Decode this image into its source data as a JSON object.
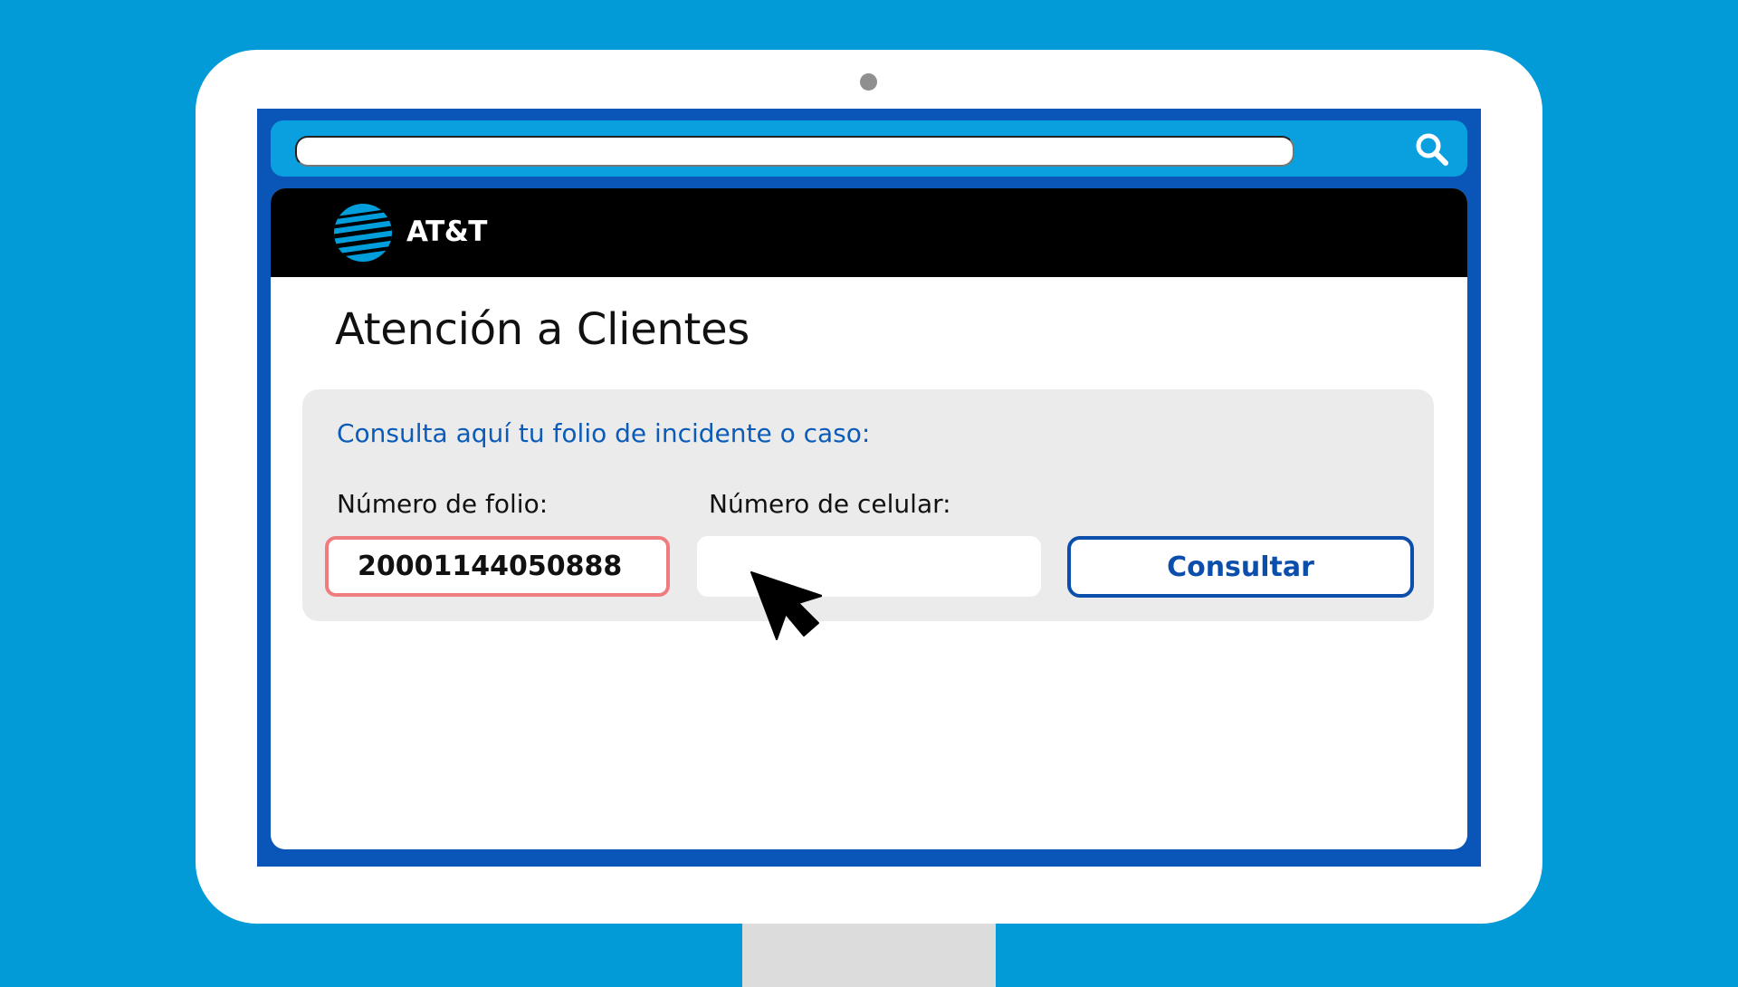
{
  "brand": {
    "name": "AT&T",
    "logo_icon": "att-globe-icon",
    "colors": {
      "background": "#039ad8",
      "screen_frame": "#0a56b8",
      "accent_blue": "#0b5cb8",
      "folio_border": "#ef7d80"
    }
  },
  "browser": {
    "address_value": "",
    "search_icon": "search-icon"
  },
  "page": {
    "title": "Atención a Clientes",
    "panel": {
      "intro": "Consulta aquí tu folio de incidente o caso:",
      "folio_label": "Número de folio:",
      "folio_value": "20001144050888",
      "celular_label": "Número de celular:",
      "celular_value": "",
      "submit_label": "Consultar"
    }
  },
  "pointer": {
    "icon": "arrow-cursor-icon"
  }
}
